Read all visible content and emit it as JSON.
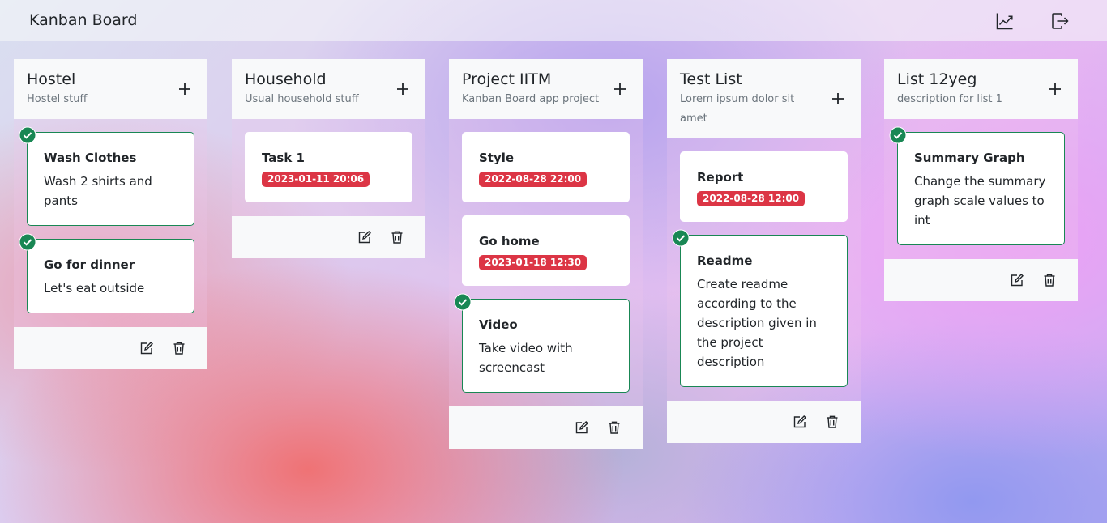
{
  "app": {
    "title": "Kanban Board"
  },
  "navbar": {
    "icons": [
      "chart-line-icon",
      "logout-icon"
    ]
  },
  "colors": {
    "danger": "#dc3545",
    "success": "#198754",
    "light": "#f8f9fa"
  },
  "lists": [
    {
      "title": "Hostel",
      "description": "Hostel stuff",
      "cards": [
        {
          "title": "Wash Clothes",
          "content": "Wash 2 shirts and pants",
          "deadline": "",
          "completed": true
        },
        {
          "title": "Go for dinner",
          "content": "Let's eat outside",
          "deadline": "",
          "completed": true
        }
      ]
    },
    {
      "title": "Household",
      "description": "Usual household stuff",
      "cards": [
        {
          "title": "Task 1",
          "content": "",
          "deadline": "2023-01-11 20:06",
          "completed": false
        }
      ]
    },
    {
      "title": "Project IITM",
      "description": "Kanban Board app project",
      "cards": [
        {
          "title": "Style",
          "content": "",
          "deadline": "2022-08-28 22:00",
          "completed": false
        },
        {
          "title": "Go home",
          "content": "",
          "deadline": "2023-01-18 12:30",
          "completed": false
        },
        {
          "title": "Video",
          "content": "Take video with screencast",
          "deadline": "",
          "completed": true
        }
      ]
    },
    {
      "title": "Test List",
      "description": "Lorem ipsum dolor sit amet",
      "cards": [
        {
          "title": "Report",
          "content": "",
          "deadline": "2022-08-28 12:00",
          "completed": false
        },
        {
          "title": "Readme",
          "content": "Create readme according to the description given in the project description",
          "deadline": "",
          "completed": true
        }
      ]
    },
    {
      "title": "List 12yeg",
      "description": "description for list 1",
      "cards": [
        {
          "title": "Summary Graph",
          "content": "Change the summary graph scale values to int",
          "deadline": "",
          "completed": true
        }
      ]
    }
  ]
}
